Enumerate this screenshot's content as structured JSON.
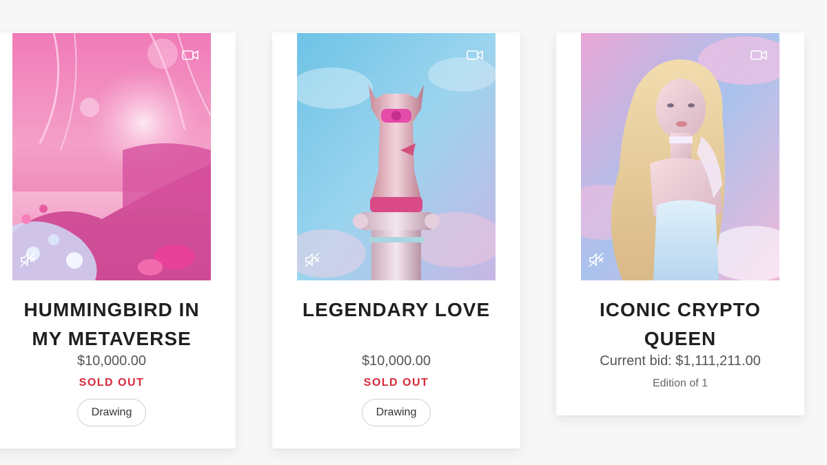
{
  "cards": [
    {
      "title_line1": "HUMMINGBIRD IN",
      "title_line2": "MY METAVERSE",
      "price": "$10,000.00",
      "status": "SOLD OUT",
      "tag": "Drawing",
      "media_type_icon": "video-camera-icon",
      "audio_icon": "muted-speaker-icon"
    },
    {
      "title_line1": "LEGENDARY LOVE",
      "price": "$10,000.00",
      "status": "SOLD OUT",
      "tag": "Drawing",
      "media_type_icon": "video-camera-icon",
      "audio_icon": "muted-speaker-icon"
    },
    {
      "title_line1": "ICONIC CRYPTO",
      "title_line2": "QUEEN",
      "price": "Current bid: $1,111,211.00",
      "edition": "Edition of 1",
      "media_type_icon": "video-camera-icon",
      "audio_icon": "muted-speaker-icon"
    }
  ],
  "colors": {
    "sold_out": "#d6283a",
    "title": "#1f1f1f",
    "price": "#555555",
    "card_bg": "#ffffff",
    "page_bg": "#f7f7f8"
  }
}
